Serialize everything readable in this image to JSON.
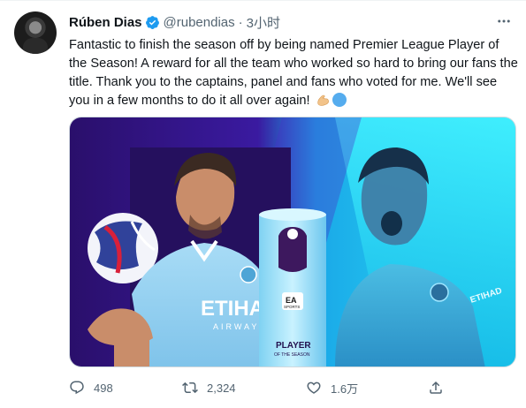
{
  "tweet": {
    "author_name": "Rúben Dias",
    "author_handle": "@rubendias",
    "separator": "·",
    "time": "3小时",
    "text": "Fantastic to finish the season off by being named Premier League Player of the Season! A reward for all the team who worked so hard to bring our fans the title. Thank you to the captains, panel and fans who voted for me. We'll see you in a few months to do it all over again!",
    "emoji": [
      "flexed-biceps",
      "blue-circle"
    ]
  },
  "media": {
    "shirt_sponsor": "ETIHAD",
    "shirt_sponsor_sub": "AIRWAYS",
    "trophy_sponsor": "EA",
    "trophy_sponsor_sub": "SPORTS",
    "trophy_title": "PLAYER",
    "trophy_subtitle": "OF THE SEASON",
    "right_shirt_text": "ETIHAD",
    "colors": {
      "purple": "#2a0f6b",
      "cyan": "#2de6f5",
      "sky_blue": "#9fd6f3"
    }
  },
  "actions": {
    "reply_count": "498",
    "retweet_count": "2,324",
    "like_count": "1.6万",
    "icons": [
      "reply-icon",
      "retweet-icon",
      "like-icon",
      "share-icon"
    ]
  }
}
